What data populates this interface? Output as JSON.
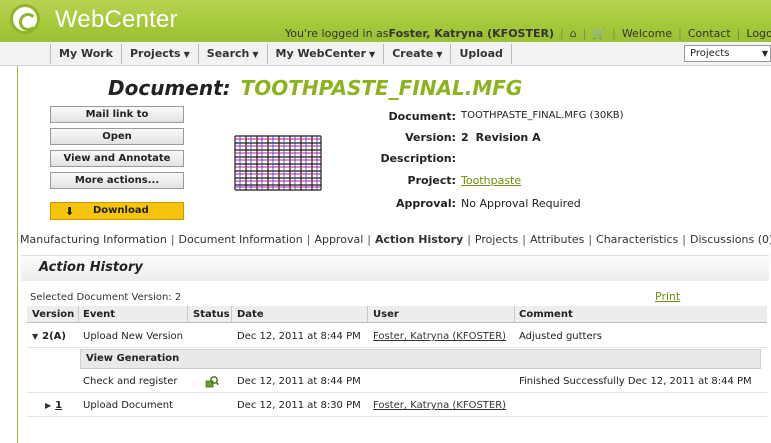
{
  "header": {
    "brand": "WebCenter",
    "logged_in_prefix": "You're logged in as ",
    "user_name": "Foster, Katryna (KFOSTER)",
    "links": [
      "Welcome",
      "Contact",
      "Logou"
    ]
  },
  "menu": {
    "items": [
      {
        "label": "My Work",
        "dropdown": false
      },
      {
        "label": "Projects",
        "dropdown": true
      },
      {
        "label": "Search",
        "dropdown": true
      },
      {
        "label": "My WebCenter",
        "dropdown": true
      },
      {
        "label": "Create",
        "dropdown": true
      },
      {
        "label": "Upload",
        "dropdown": false
      }
    ],
    "context_select": "Projects"
  },
  "document": {
    "title_prefix": "Document:",
    "title_name": "TOOTHPASTE_FINAL.MFG",
    "buttons": {
      "mail_link": "Mail link to",
      "open": "Open",
      "view_annotate": "View and Annotate",
      "more_actions": "More actions...",
      "download": "Download"
    },
    "properties": {
      "document_label": "Document:",
      "document_value": "TOOTHPASTE_FINAL.MFG (30KB)",
      "version_label": "Version:",
      "version_value": "2",
      "revision_value": "Revision A",
      "description_label": "Description:",
      "description_value": "",
      "project_label": "Project:",
      "project_value": "Toothpaste",
      "approval_label": "Approval:",
      "approval_value": "No Approval Required"
    }
  },
  "tabs": [
    {
      "label": "Manufacturing Information",
      "active": false
    },
    {
      "label": "Document Information",
      "active": false
    },
    {
      "label": "Approval",
      "active": false
    },
    {
      "label": "Action History",
      "active": true
    },
    {
      "label": "Projects",
      "active": false
    },
    {
      "label": "Attributes",
      "active": false
    },
    {
      "label": "Characteristics",
      "active": false
    },
    {
      "label": "Discussions (0)",
      "active": false
    }
  ],
  "history": {
    "title": "Action History",
    "selected_version": "Selected Document Version: 2",
    "print_label": "Print",
    "columns": [
      "Version",
      "Event",
      "Status",
      "Date",
      "User",
      "Comment"
    ],
    "rows": [
      {
        "version": "2(A)",
        "event": "Upload New Version",
        "status": "",
        "date": "Dec 12, 2011 at 8:44 PM",
        "user": "Foster, Katryna (KFOSTER)",
        "comment": "Adjusted gutters"
      },
      {
        "version": "1",
        "event": "Upload Document",
        "status": "",
        "date": "Dec 12, 2011 at 8:30 PM",
        "user": "Foster, Katryna (KFOSTER)",
        "comment": ""
      }
    ],
    "sub_header": "View Generation",
    "sub_row": {
      "event": "Check and register",
      "status_icon": "check-register-icon",
      "date": "Dec 12, 2011 at 8:44 PM",
      "comment": "Finished Successfully Dec 12, 2011 at 8:44 PM"
    }
  },
  "colors": {
    "banner_green": "#a6c93c",
    "title_green": "#8bb31b",
    "link_green": "#6a8f12",
    "download_yellow": "#f6c40a"
  }
}
